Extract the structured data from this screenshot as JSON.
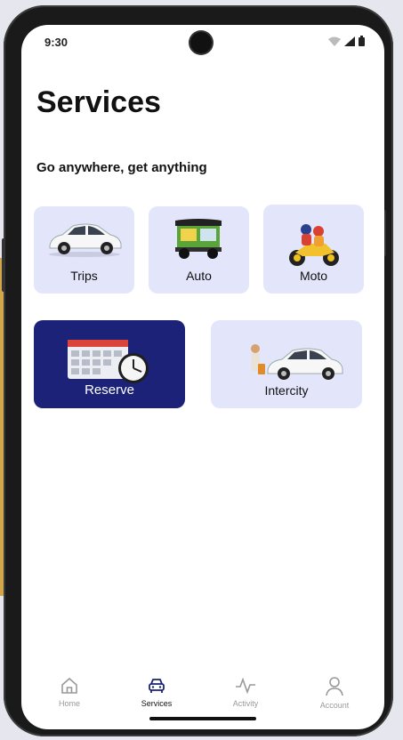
{
  "status": {
    "time": "9:30"
  },
  "page": {
    "title": "Services",
    "subtitle": "Go anywhere, get anything"
  },
  "services": [
    {
      "label": "Trips",
      "icon": "car-icon"
    },
    {
      "label": "Auto",
      "icon": "auto-rickshaw-icon"
    },
    {
      "label": "Moto",
      "icon": "motorbike-icon"
    },
    {
      "label": "Reserve",
      "icon": "calendar-clock-icon",
      "highlighted": true
    },
    {
      "label": "Intercity",
      "icon": "car-traveler-icon"
    }
  ],
  "nav": [
    {
      "label": "Home",
      "icon": "home-icon"
    },
    {
      "label": "Services",
      "icon": "car-front-icon",
      "active": true
    },
    {
      "label": "Activity",
      "icon": "activity-icon"
    },
    {
      "label": "Account",
      "icon": "person-icon"
    }
  ],
  "colors": {
    "card_bg": "#e3e6fb",
    "highlight": "#1b2277",
    "active_nav": "#1b2277"
  }
}
